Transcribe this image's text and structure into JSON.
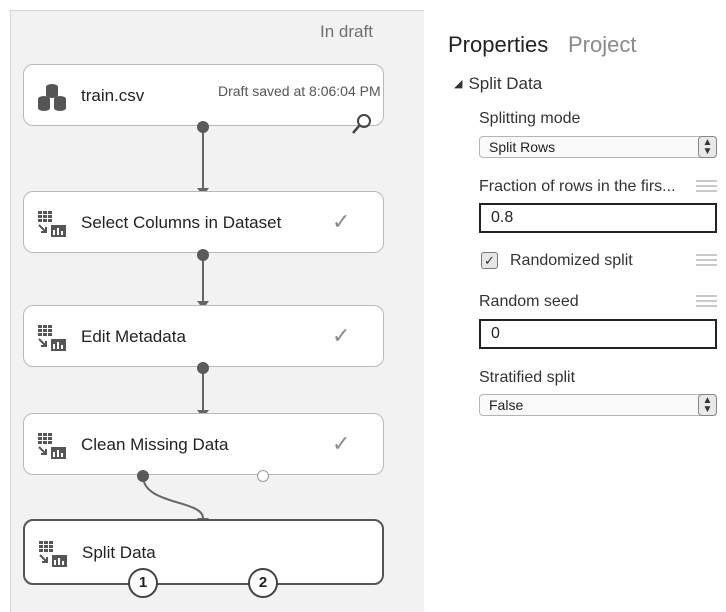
{
  "canvas": {
    "status": "In draft",
    "modules": [
      {
        "name": "train.csv",
        "note": "Draft saved at 8:06:04 PM"
      },
      {
        "name": "Select Columns in Dataset",
        "status": "✓"
      },
      {
        "name": "Edit Metadata",
        "status": "✓"
      },
      {
        "name": "Clean Missing Data",
        "status": "✓"
      },
      {
        "name": "Split Data",
        "outputs": [
          "1",
          "2"
        ]
      }
    ]
  },
  "properties": {
    "tabs": [
      "Properties",
      "Project"
    ],
    "active_tab": "Properties",
    "section": "Split Data",
    "splitting_mode": {
      "label": "Splitting mode",
      "value": "Split Rows",
      "arrow": "⌃⌄"
    },
    "fraction": {
      "label": "Fraction of rows in the firs...",
      "value": "0.8"
    },
    "randomized": {
      "label": "Randomized split",
      "checked": true,
      "mark": "✓"
    },
    "random_seed": {
      "label": "Random seed",
      "value": "0"
    },
    "stratified": {
      "label": "Stratified split",
      "value": "False",
      "arrow": "⌃⌄"
    }
  }
}
